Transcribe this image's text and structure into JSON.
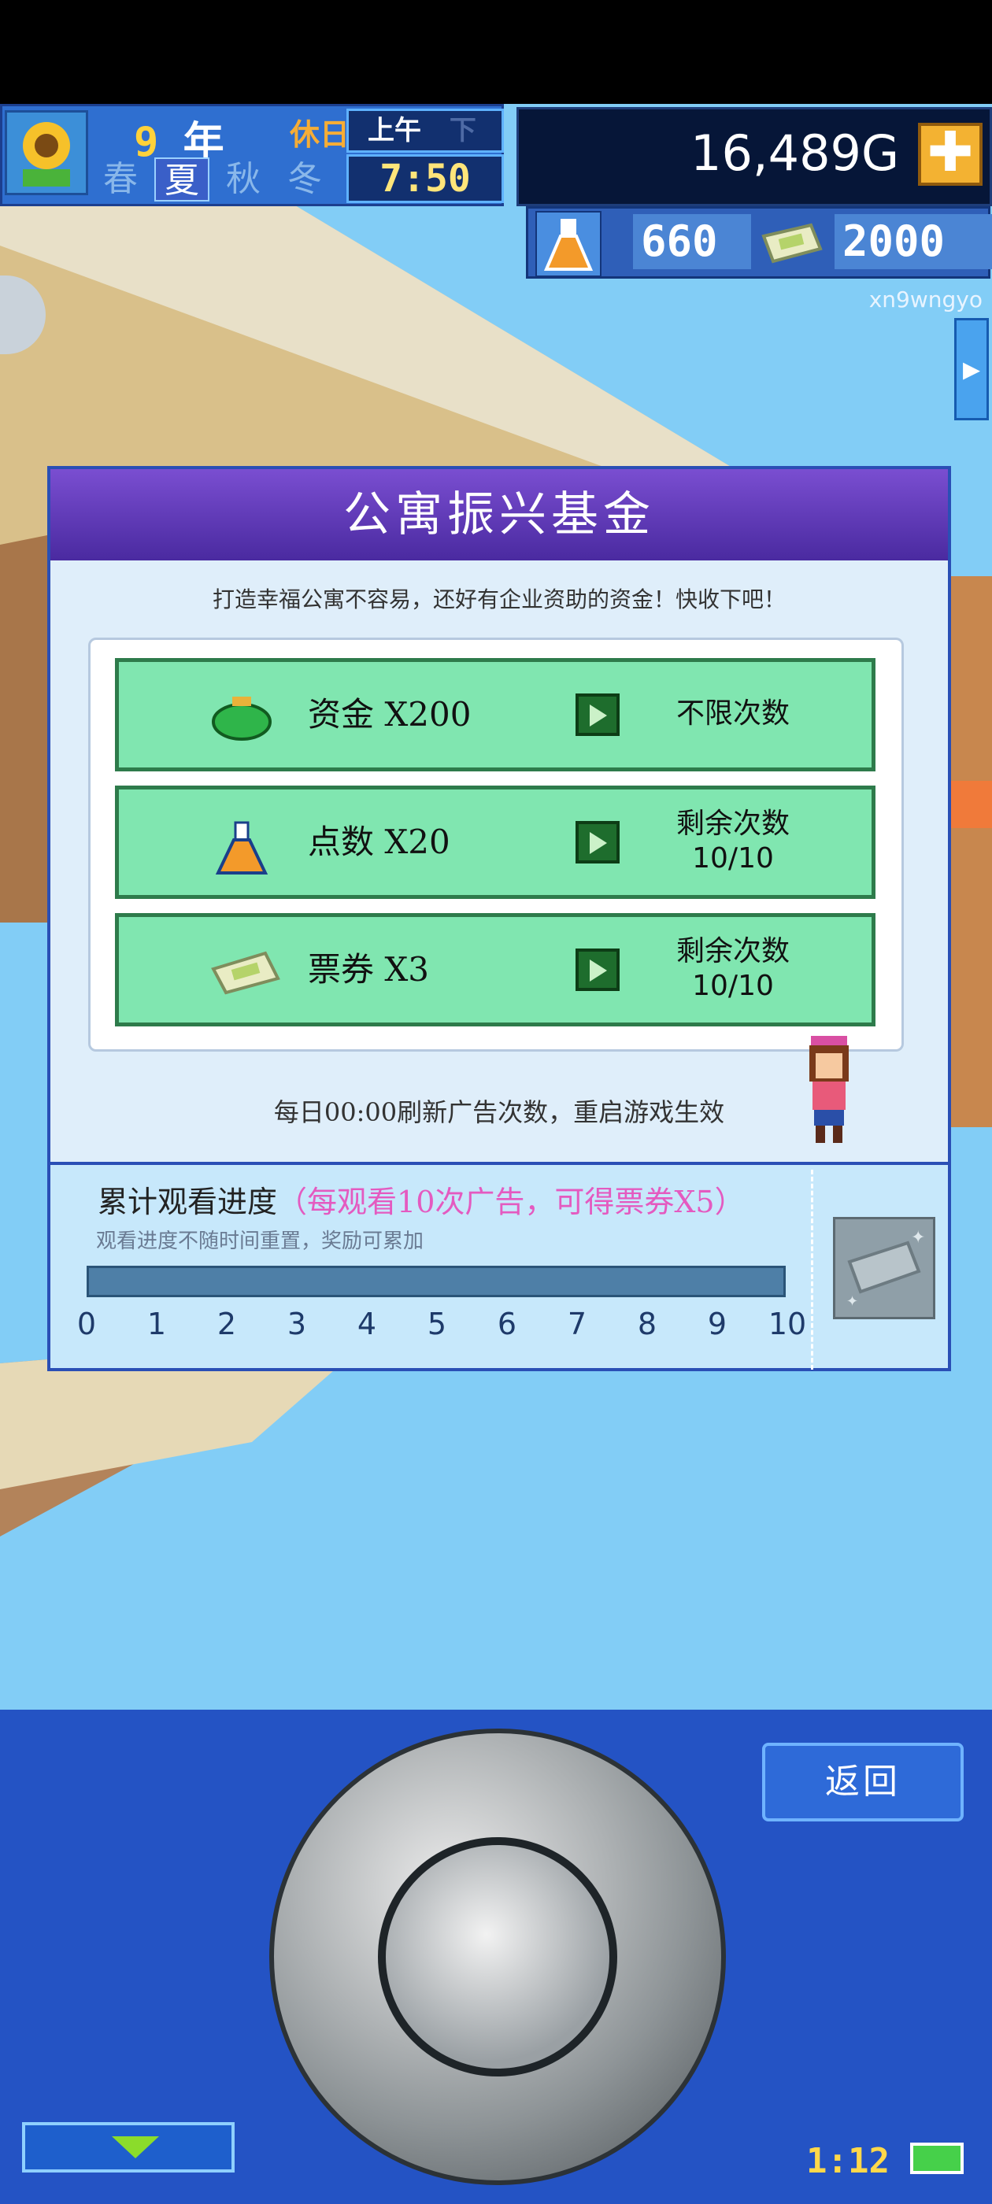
{
  "hud": {
    "year_num": "9",
    "year_unit": "年",
    "holiday": "休日",
    "am": "上午",
    "pm": "下午",
    "time": "7:50",
    "seasons": [
      "春",
      "夏",
      "秋",
      "冬"
    ],
    "active_season": "夏",
    "money": "16,489G",
    "plus": "✚",
    "research_points": "660",
    "tickets": "2000",
    "user_id": "xn9wngyo"
  },
  "dialog": {
    "title": "公寓振兴基金",
    "subtitle": "打造幸福公寓不容易，还好有企业资助的资金！快收下吧！",
    "rows": [
      {
        "label": "资金 X200",
        "count": "不限次数",
        "count2": ""
      },
      {
        "label": "点数 X20",
        "count": "剩余次数",
        "count2": "10/10"
      },
      {
        "label": "票券 X3",
        "count": "剩余次数",
        "count2": "10/10"
      }
    ],
    "note": "每日00:00刷新广告次数，重启游戏生效",
    "progress_title": "累计观看进度",
    "progress_bonus": "（每观看10次广告，可得票券X5）",
    "progress_sub": "观看进度不随时间重置，奖励可累加",
    "progress_value": 0,
    "ticks": [
      "0",
      "1",
      "2",
      "3",
      "4",
      "5",
      "6",
      "7",
      "8",
      "9",
      "10"
    ]
  },
  "controls": {
    "back": "返回",
    "time": "1:12"
  },
  "colors": {
    "row_bg": "#80e6b0",
    "title_bg": "#5a35b8",
    "panel_bg": "#2453c4"
  }
}
